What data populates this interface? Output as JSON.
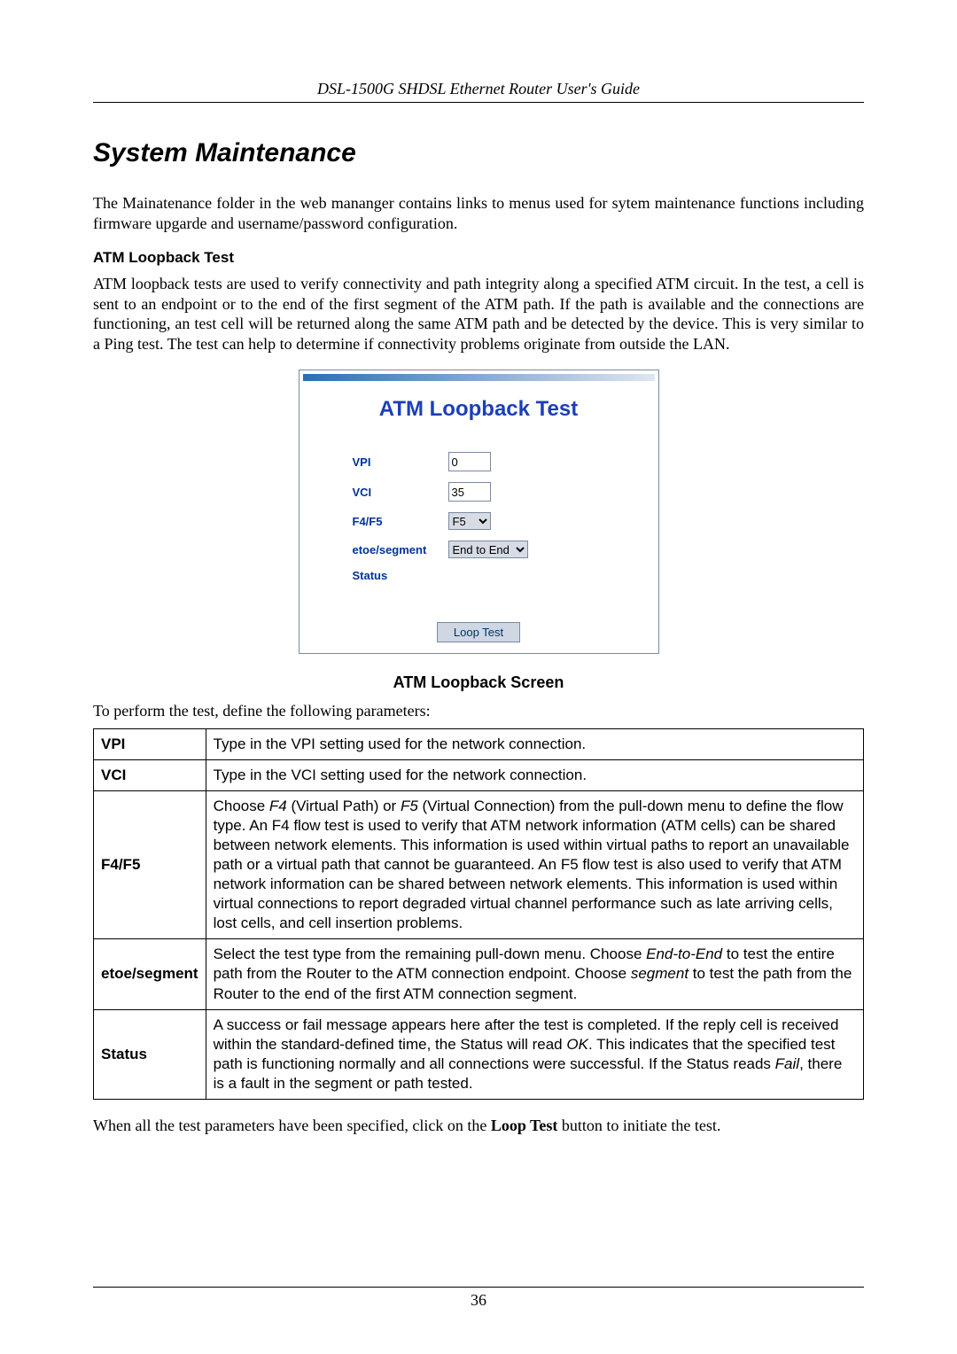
{
  "header": "DSL-1500G SHDSL Ethernet Router User's Guide",
  "title": "System Maintenance",
  "intro": "The Mainatenance folder in the web mananger contains links to menus used for sytem maintenance functions including firmware upgarde and username/password configuration.",
  "atm_heading": "ATM Loopback Test",
  "atm_para": "ATM loopback tests are used to verify connectivity and path integrity along a specified ATM circuit. In the test, a cell is sent to an endpoint or to the end of the first segment of the ATM path. If the path is available and the connections are functioning, an test cell will be returned along the same ATM path and be detected by the device. This is very similar to a Ping test. The test can help to determine if connectivity problems originate from outside the LAN.",
  "panel": {
    "title": "ATM Loopback Test",
    "labels": {
      "vpi": "VPI",
      "vci": "VCI",
      "f4f5": "F4/F5",
      "etoe": "etoe/segment",
      "status": "Status"
    },
    "values": {
      "vpi": "0",
      "vci": "35",
      "f4f5": "F5",
      "etoe": "End to End",
      "status": ""
    },
    "button": "Loop Test"
  },
  "caption": "ATM Loopback Screen",
  "table_intro": "To perform the test, define the following parameters:",
  "chart_data": {
    "type": "table",
    "rows": [
      {
        "param": "VPI",
        "desc": "Type in the VPI setting used for the network connection."
      },
      {
        "param": "VCI",
        "desc": "Type in the VCI setting used for the network connection."
      },
      {
        "param": "F4/F5",
        "desc_html": "Choose <span class='italic'>F4</span> (Virtual Path) or <span class='italic'>F5</span> (Virtual Connection) from the pull-down menu to define the flow type. An F4 flow test is used to verify that ATM network information (ATM cells) can be shared between network elements. This information is used within virtual paths to report an unavailable path or a virtual path that cannot be guaranteed. An F5 flow test is also used to verify that ATM network information can be shared between network elements. This information is used within virtual connections to report degraded virtual channel performance such as late arriving cells, lost cells, and cell insertion problems."
      },
      {
        "param": "etoe/segment",
        "desc_html": "Select the test type from the remaining pull-down menu. Choose <span class='italic'>End-to-End</span> to test the entire path from the Router to the ATM connection endpoint. Choose <span class='italic'>segment</span> to test the path from the Router to the end of the first ATM connection segment."
      },
      {
        "param": "Status",
        "desc_html": "A success or fail message appears here after the test is completed. If the reply cell is received within the standard-defined time, the Status will read <span class='italic'>OK</span>. This indicates that the specified test path is functioning normally and all connections were successful. If the Status reads <span class='italic'>Fail</span>, there is a fault in the segment or path tested."
      }
    ]
  },
  "closing_pre": "When all the test parameters have been specified, click on the ",
  "closing_bold": "Loop Test",
  "closing_post": " button to initiate the test.",
  "page_number": "36"
}
